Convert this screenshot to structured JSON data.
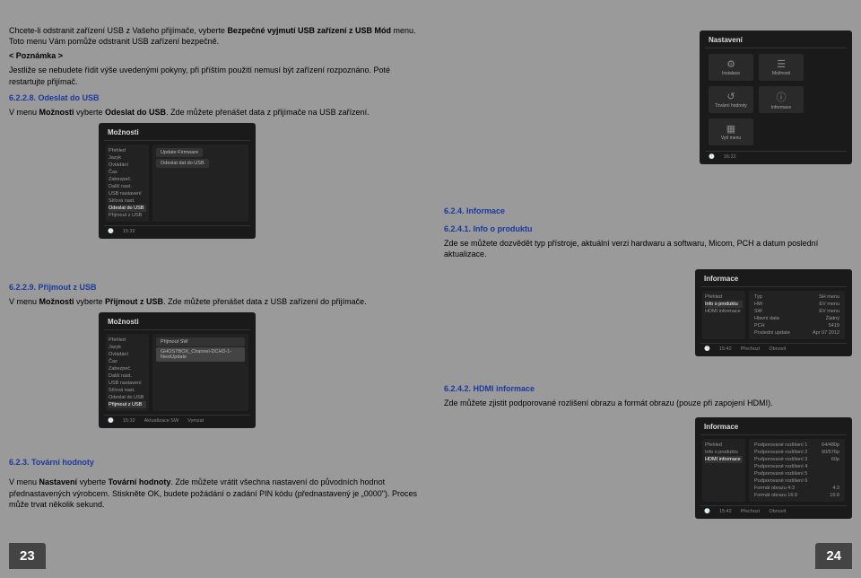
{
  "left": {
    "intro1a": "Chcete-li odstranit zařízení USB z Vašeho přijímače, vyberte ",
    "intro1b": "Bezpečné vyjmutí USB zařízení z USB Mód",
    "intro1c": " menu. Toto menu Vám pomůže odstranit USB zařízení bezpečně.",
    "noteLabel": "< Poznámka >",
    "noteText": "Jestliže se nebudete řídit výše uvedenými pokyny, při příštím použití nemusí být zařízení rozpoznáno. Poté restartujte přijímač.",
    "s628_title": "6.2.2.8. Odeslat do USB",
    "s628_a": "V menu ",
    "s628_b": "Možnosti",
    "s628_c": " vyberte ",
    "s628_d": "Odeslat do USB",
    "s628_e": ". Zde můžete přenášet data z přijímače na USB zařízení.",
    "s629_title": "6.2.2.9. Přijmout z USB",
    "s629_a": "V menu ",
    "s629_b": "Možnosti",
    "s629_c": " vyberte ",
    "s629_d": "Přijmout z USB",
    "s629_e": ". Zde můžete přenášet data z USB zařízení do přijímače.",
    "s623_title": "6.2.3. Tovární hodnoty",
    "s623_a": "V menu ",
    "s623_b": "Nastavení",
    "s623_c": " vyberte ",
    "s623_d": "Tovární hodnoty",
    "s623_e": ". Zde můžete vrátit všechna nastavení do původních hodnot přednastavených výrobcem. Stiskněte OK, budete požádání o zadání PIN kódu (přednastavený je „0000\"). Proces může trvat několik sekund.",
    "fig_moznosti": {
      "title": "Možnosti",
      "side": [
        "Přehled",
        "Jazyk",
        "Ovládání",
        "Čas",
        "Zabezpeč.",
        "Další nast.",
        "USB nastavení",
        "Síťová nast.",
        "Odeslat do USB",
        "Přijmout z USB"
      ],
      "opts": [
        "Update Firmware",
        "Odeslat dat do USB"
      ],
      "foot": [
        "15:32"
      ]
    },
    "fig_moznosti2": {
      "title": "Možnosti",
      "side": [
        "Přehled",
        "Jazyk",
        "Ovládání",
        "Čas",
        "Zabezpeč.",
        "Další nast.",
        "USB nastavení",
        "Síťová nast.",
        "Odeslat do USB",
        "Přijmout z USB"
      ],
      "main_line1": "Přijmout SW",
      "main_line2": "GHOSTBOX_Channel-DCHD-1-NextUpdate",
      "foot": [
        "15:32",
        "Aktualizace SW",
        "Vymzat"
      ]
    }
  },
  "right": {
    "fig_nastaveni": {
      "title": "Nastavení",
      "tiles": [
        {
          "icon": "⚙",
          "label": "Instalace"
        },
        {
          "icon": "☰",
          "label": "Možnosti"
        },
        {
          "icon": "↺",
          "label": "Tovární hodnoty"
        },
        {
          "icon": "i",
          "label": "Informace"
        },
        {
          "icon": "▦",
          "label": "Vytí menu"
        }
      ],
      "foot": [
        "16:22"
      ]
    },
    "s624_title": "6.2.4. Informace",
    "s6241_title": "6.2.4.1. Info o produktu",
    "s6241_text": "Zde se můžete dozvědět typ přístroje, aktuální verzi hardwaru a softwaru, Micom, PCH a datum poslední aktualizace.",
    "fig_info1": {
      "title": "Informace",
      "side": [
        "Přehled",
        "Info o produktu",
        "HDMI informace"
      ],
      "rows": [
        [
          "Typ",
          "SH menu"
        ],
        [
          "HW",
          "EV menu"
        ],
        [
          "SW",
          "EV menu"
        ],
        [
          "Hlavní data",
          "Žádný"
        ],
        [
          "PCH",
          "5419"
        ],
        [
          "Poslední update",
          "Apr 07 2012"
        ]
      ],
      "foot": [
        "15:42",
        "Přechozí",
        "Obnovit"
      ]
    },
    "s6242_title": "6.2.4.2. HDMI informace",
    "s6242_text": "Zde můžete zjistit podporované rozlišení obrazu a formát obrazu (pouze při zapojení HDMI).",
    "fig_info2": {
      "title": "Informace",
      "side": [
        "Přehled",
        "Info o produktu",
        "HDMI informace"
      ],
      "rows": [
        [
          "Podporované rozlišení 1",
          "64/480p"
        ],
        [
          "Podporované rozlišení 2",
          "60/576p"
        ],
        [
          "Podporované rozlišení 3",
          "60p"
        ],
        [
          "Podporované rozlišení 4",
          ""
        ],
        [
          "Podporované rozlišení 5",
          ""
        ],
        [
          "Podporované rozlišení 6",
          ""
        ],
        [
          "Formát obrazu 4:3",
          "4:3"
        ],
        [
          "Formát obrazu 16:9",
          "16:9"
        ]
      ],
      "foot": [
        "15:42",
        "Přechozí",
        "Obnovit"
      ]
    }
  },
  "pages": {
    "left": "23",
    "right": "24"
  }
}
